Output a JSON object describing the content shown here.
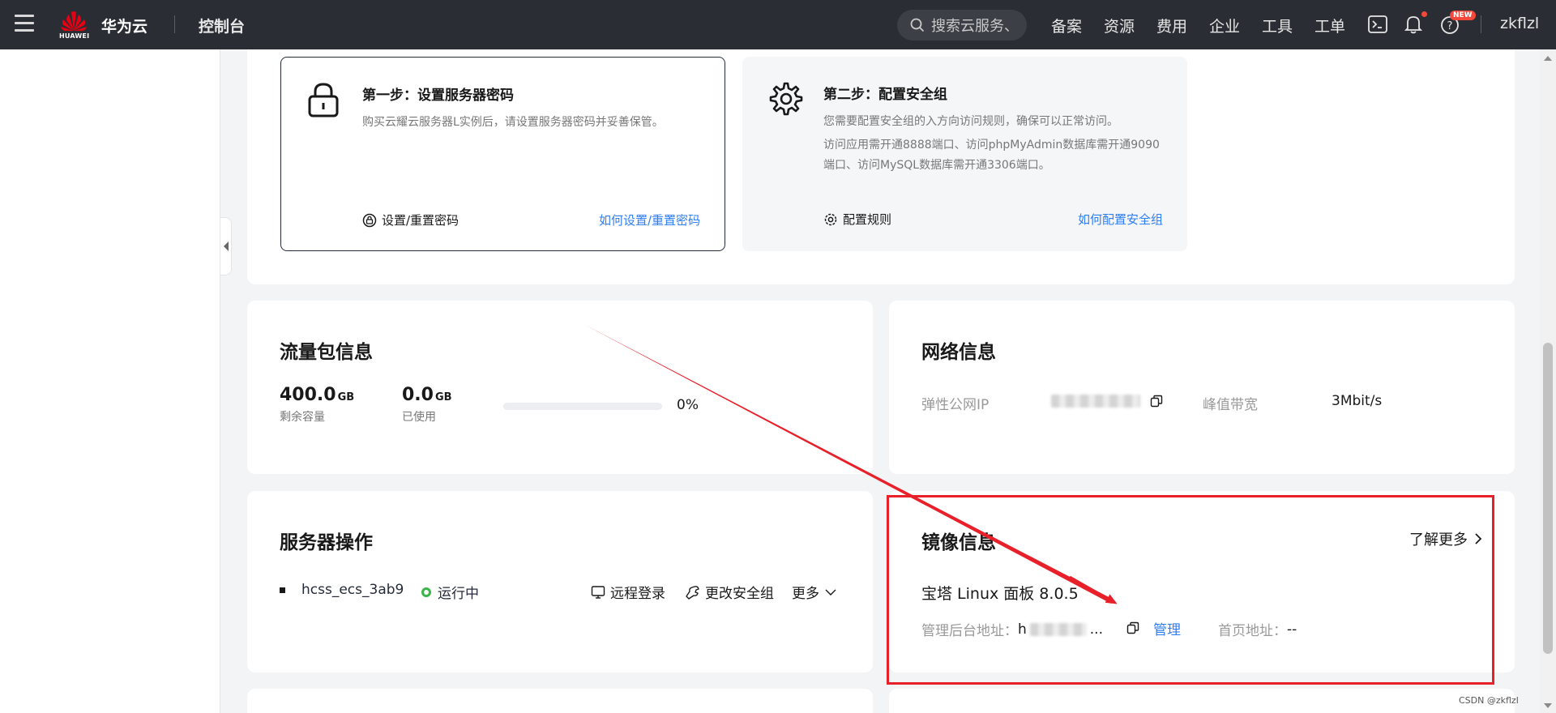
{
  "topbar": {
    "logo_text": "HUAWEI",
    "brand": "华为云",
    "console": "控制台",
    "search_placeholder": "搜索云服务、",
    "nav": [
      "备案",
      "资源",
      "费用",
      "企业",
      "工具",
      "工单"
    ],
    "new_badge": "NEW",
    "user": "zkflzl"
  },
  "steps": [
    {
      "title": "第一步：设置服务器密码",
      "desc": "购买云耀云服务器L实例后，请设置服务器密码并妥善保管。",
      "action": "设置/重置密码",
      "link": "如何设置/重置密码",
      "icon": "lock-icon"
    },
    {
      "title": "第二步：配置安全组",
      "desc1": "您需要配置安全组的入方向访问规则，确保可以正常访问。",
      "desc2": "访问应用需开通8888端口、访问phpMyAdmin数据库需开通9090端口、访问MySQL数据库需开通3306端口。",
      "action": "配置规则",
      "link": "如何配置安全组",
      "icon": "gear-icon"
    }
  ],
  "traffic": {
    "title": "流量包信息",
    "remaining_value": "400.0",
    "remaining_unit": "GB",
    "remaining_label": "剩余容量",
    "used_value": "0.0",
    "used_unit": "GB",
    "used_label": "已使用",
    "percent_text": "0%",
    "percent": 0
  },
  "network": {
    "title": "网络信息",
    "eip_label": "弹性公网IP",
    "bandwidth_label": "峰值带宽",
    "bandwidth_value": "3Mbit/s"
  },
  "server_ops": {
    "title": "服务器操作",
    "name": "hcss_ecs_3ab9",
    "status": "运行中",
    "remote_login": "远程登录",
    "change_sg": "更改安全组",
    "more": "更多"
  },
  "image_info": {
    "title": "镜像信息",
    "learn_more": "了解更多",
    "image_name": "宝塔 Linux 面板 8.0.5",
    "admin_label": "管理后台地址：",
    "admin_value_prefix": "h",
    "admin_value_suffix": "...",
    "manage": "管理",
    "home_label": "首页地址：",
    "home_value": "--"
  },
  "watermark": "CSDN @zkflzl",
  "colors": {
    "accent": "#2e7ef6",
    "topbar": "#2a2d33",
    "status_ok": "#3bb54a",
    "annotation_red": "#e8202a"
  }
}
